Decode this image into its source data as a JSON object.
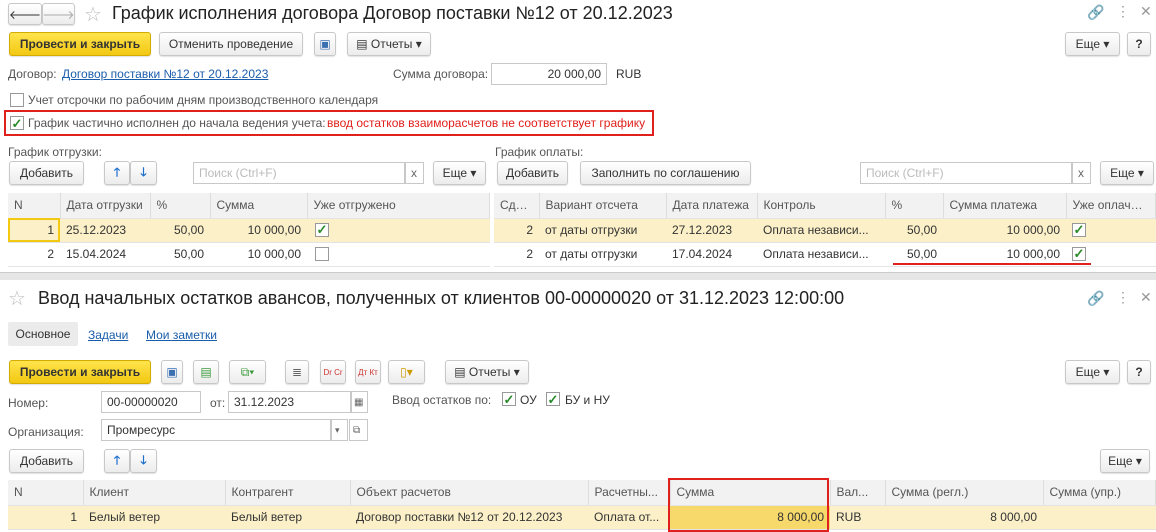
{
  "window1": {
    "title": "График исполнения договора Договор поставки №12 от 20.12.2023",
    "post_close": "Провести и закрыть",
    "cancel_post": "Отменить проведение",
    "reports": "Отчеты",
    "more": "Еще",
    "help": "?",
    "contract_label": "Договор:",
    "contract_link": "Договор поставки №12 от 20.12.2023",
    "sum_label": "Сумма договора:",
    "sum_value": "20 000,00",
    "currency": "RUB",
    "cb1_label": "Учет отсрочки по рабочим дням производственного календаря",
    "cb1_checked": false,
    "cb2_label": "График частично исполнен до начала ведения учета:",
    "cb2_checked": true,
    "warning": "ввод остатков взаиморасчетов не соответствует графику",
    "ship": {
      "title": "График отгрузки:",
      "add": "Добавить",
      "search_placeholder": "Поиск (Ctrl+F)",
      "clear": "x",
      "more": "Еще",
      "columns": [
        "N",
        "Дата отгрузки",
        "%",
        "Сумма",
        "Уже отгружено"
      ],
      "rows": [
        [
          "1",
          "25.12.2023",
          "50,00",
          "10 000,00"
        ],
        [
          "2",
          "15.04.2024",
          "50,00",
          "10 000,00"
        ]
      ],
      "checked": [
        true,
        false
      ]
    },
    "pay": {
      "title": "График оплаты:",
      "add": "Добавить",
      "fill": "Заполнить по соглашению",
      "search_placeholder": "Поиск (Ctrl+F)",
      "clear": "x",
      "more": "Еще",
      "columns": [
        "Сдвиг",
        "Вариант отсчета",
        "Дата платежа",
        "Контроль",
        "%",
        "Сумма платежа",
        "Уже оплачено"
      ],
      "rows": [
        [
          "2",
          "от даты отгрузки",
          "27.12.2023",
          "Оплата независи...",
          "50,00",
          "10 000,00"
        ],
        [
          "2",
          "от даты отгрузки",
          "17.04.2024",
          "Оплата независи...",
          "50,00",
          "10 000,00"
        ]
      ],
      "checked": [
        true,
        true
      ]
    }
  },
  "window2": {
    "title": "Ввод начальных остатков авансов, полученных от клиентов 00-00000020 от 31.12.2023 12:00:00",
    "tabs": [
      "Основное",
      "Задачи",
      "Мои заметки"
    ],
    "post_close": "Провести и закрыть",
    "reports": "Отчеты",
    "more": "Еще",
    "help": "?",
    "number_label": "Номер:",
    "number": "00-00000020",
    "from_label": "от:",
    "date": "31.12.2023",
    "balances_label": "Ввод остатков по:",
    "ou": "ОУ",
    "bu": "БУ и НУ",
    "org_label": "Организация:",
    "org": "Промресурс",
    "add": "Добавить",
    "more2": "Еще",
    "columns": [
      "N",
      "Клиент",
      "Контрагент",
      "Объект расчетов",
      "Расчетны...",
      "Сумма",
      "Вал...",
      "Сумма (регл.)",
      "Сумма (упр.)"
    ],
    "rows": [
      [
        "1",
        "Белый ветер",
        "Белый ветер",
        "Договор поставки №12 от 20.12.2023",
        "Оплата от...",
        "8 000,00",
        "RUB",
        "8 000,00",
        ""
      ]
    ]
  },
  "colors": {
    "accent_yellow": "#f2c811",
    "warning_red": "#e0201c",
    "link": "#1a5dab"
  }
}
